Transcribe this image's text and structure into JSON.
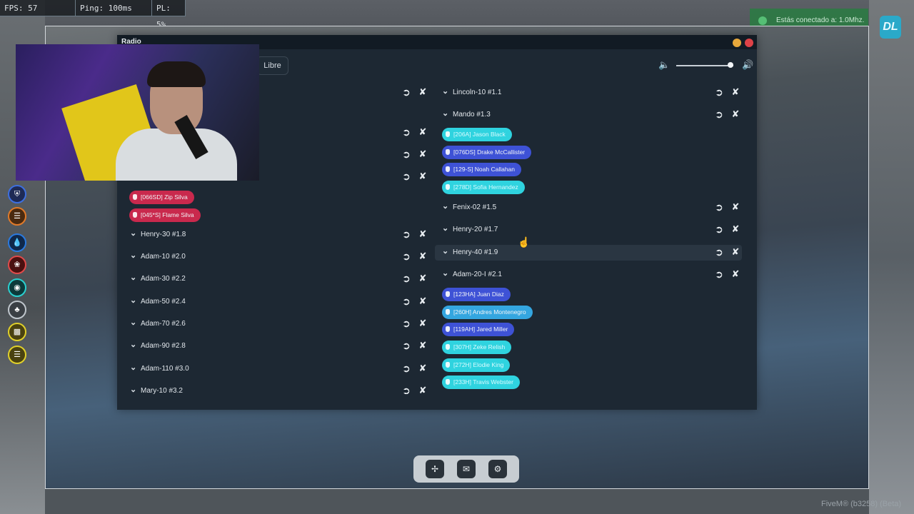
{
  "hud": {
    "fps": "FPS: 57",
    "ping": "Ping: 100ms",
    "pl": "PL: 5%"
  },
  "notification": {
    "text": "Estás conectado a: 1.0Mhz."
  },
  "logo": {
    "text": "DL"
  },
  "radio": {
    "title": "Radio",
    "tab_label": "Libre",
    "volume_fraction": 0.95,
    "left_channels": [
      {
        "label": ""
      },
      {
        "label": ""
      },
      {
        "label": ""
      },
      {
        "label": ""
      },
      {
        "label": "Henry-30 #1.8"
      },
      {
        "label": "Adam-10 #2.0"
      },
      {
        "label": "Adam-30 #2.2"
      },
      {
        "label": "Adam-50 #2.4"
      },
      {
        "label": "Adam-70 #2.6"
      },
      {
        "label": "Adam-90 #2.8"
      },
      {
        "label": "Adam-110 #3.0"
      },
      {
        "label": "Mary-10 #3.2"
      }
    ],
    "left_members": [
      "[066SD] Zip Silva",
      "[045*S] Flame Silva"
    ],
    "right_channels": [
      {
        "label": "Lincoln-10 #1.1"
      },
      {
        "label": "Mando #1.3"
      },
      {
        "label": "Fenix-02 #1.5"
      },
      {
        "label": "Henry-20 #1.7"
      },
      {
        "label": "Henry-40 #1.9"
      },
      {
        "label": "Adam-20-I #2.1"
      }
    ],
    "mando_members": [
      "[206A] Jason Black",
      "[076DS] Drake McCallister",
      "[129-S] Noah Callahan",
      "[278D] Sofia Hernandez"
    ],
    "adam20_members": [
      "[123HA] Juan Diaz",
      "[260H] Andres Montenegro",
      "[119AH] Jared Miller",
      "[307H] Zeke Relish",
      "[272H] Elodie King",
      "[233H] Travis Webster"
    ]
  },
  "dock": {
    "icons": [
      "radio-tower-icon",
      "inbox-icon",
      "settings-icon"
    ]
  },
  "footer": {
    "text": "FiveM® (b3258) (Beta)"
  },
  "colors": {
    "panel": "#1d2833",
    "titlebar": "#121b24",
    "red_member": "#c9294d",
    "blue_member": "#3e52d6",
    "cyan_member": "#2fd3df",
    "light_blue_member": "#34a6e0",
    "minimize": "#e7a83b",
    "close": "#de4247"
  }
}
